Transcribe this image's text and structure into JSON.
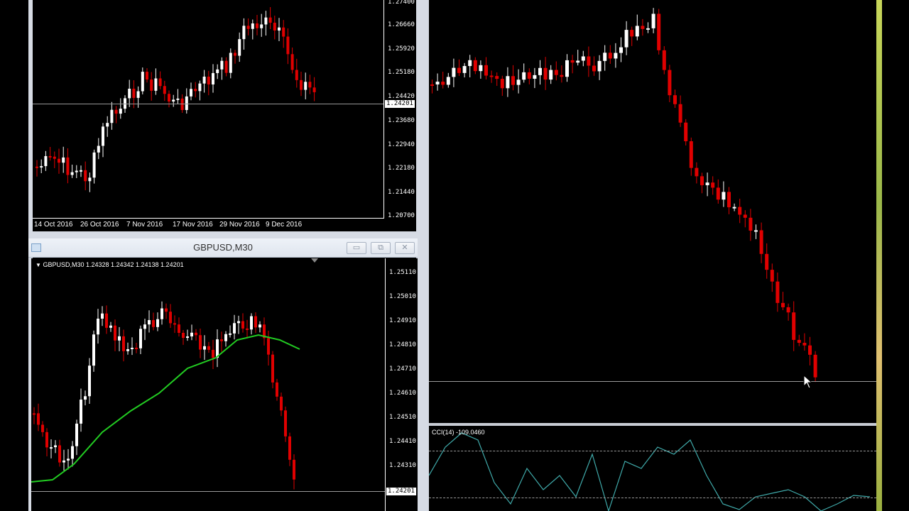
{
  "top_left_chart": {
    "price_axis": [
      "1.27400",
      "1.26660",
      "1.25920",
      "1.25180",
      "1.24420",
      "1.23680",
      "1.22940",
      "1.22180",
      "1.21440",
      "1.20700"
    ],
    "current_price": "1.24201",
    "date_axis": [
      "14 Oct 2016",
      "26 Oct 2016",
      "7 Nov 2016",
      "17 Nov 2016",
      "29 Nov 2016",
      "9 Dec 2016"
    ]
  },
  "bottom_left_window": {
    "title": "GBPUSD,M30",
    "minimize_glyph": "▭",
    "restore_glyph": "⧉",
    "close_glyph": "✕",
    "symbol_info": "GBPUSD,M30  1.24328 1.24342 1.24138 1.24201",
    "price_axis": [
      "1.25110",
      "1.25010",
      "1.24910",
      "1.24810",
      "1.24710",
      "1.24610",
      "1.24510",
      "1.24410",
      "1.24310"
    ],
    "current_price": "1.24201"
  },
  "right_chart": {
    "indicator_label": "CCI(14) -109.0460"
  },
  "colors": {
    "bull": "#ffffff",
    "bear": "#e00000",
    "ma": "#22cc22",
    "cci": "#3fa9a9",
    "frame": "#d6dbe4"
  },
  "icons": [
    "collapse-triangle-icon",
    "window-icon",
    "minimize-icon",
    "restore-icon",
    "close-icon",
    "mouse-cursor-icon"
  ]
}
